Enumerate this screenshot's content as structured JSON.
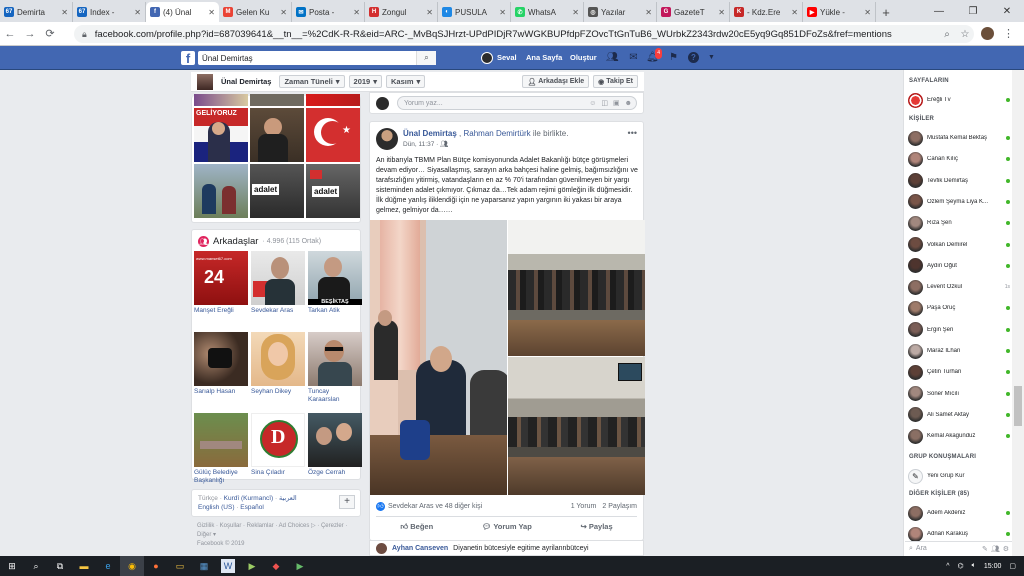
{
  "browser": {
    "tabs": [
      {
        "label": "Demirta",
        "icon": "67-site-icon",
        "color": "#1565c0",
        "glyph": "67",
        "active": false
      },
      {
        "label": "Index - ",
        "icon": "67-site-icon",
        "color": "#1565c0",
        "glyph": "67",
        "active": false
      },
      {
        "label": "(4) Ünal",
        "icon": "facebook-icon",
        "color": "#4267b2",
        "glyph": "f",
        "active": true
      },
      {
        "label": "Gelen Ku",
        "icon": "gmail-icon",
        "color": "#ea4335",
        "glyph": "M",
        "active": false
      },
      {
        "label": "Posta - ",
        "icon": "outlook-icon",
        "color": "#0072c6",
        "glyph": "✉",
        "active": false
      },
      {
        "label": "Zongul",
        "icon": "h-site-icon",
        "color": "#d32f2f",
        "glyph": "H",
        "active": false
      },
      {
        "label": "PUSULA",
        "icon": "pusula-icon",
        "color": "#1e88e5",
        "glyph": "◐",
        "active": false
      },
      {
        "label": "WhatsA",
        "icon": "whatsapp-icon",
        "color": "#25d366",
        "glyph": "✆",
        "active": false
      },
      {
        "label": "Yazılar ",
        "icon": "globe-icon",
        "color": "#555555",
        "glyph": "◎",
        "active": false
      },
      {
        "label": "GazeteT",
        "icon": "gazete-icon",
        "color": "#c2185b",
        "glyph": "G",
        "active": false
      },
      {
        "label": "- Kdz.Ere",
        "icon": "kdz-icon",
        "color": "#c62828",
        "glyph": "K",
        "active": false
      },
      {
        "label": "Yükle - ",
        "icon": "youtube-icon",
        "color": "#ff0000",
        "glyph": "▶",
        "active": false
      }
    ],
    "url": "facebook.com/profile.php?id=687039641&__tn__=%2CdK-R-R&eid=ARC-_MvBqSJHrzt-UPdPIDjR7wWGKBUPfdpFZOvcTtGnTuB6_WUrbkZ2343rdw20cE5yq9Gq851DFoZs&fref=mentions"
  },
  "fbheader": {
    "search_value": "Ünal Demirtaş",
    "user": "Seval",
    "home": "Ana Sayfa",
    "create": "Oluştur",
    "notif_count": "4"
  },
  "timeline_bar": {
    "name": "Ünal Demirtaş",
    "timeline": "Zaman Tüneli",
    "year": "2019",
    "month": "Kasım",
    "add_friend": "Arkadaşı Ekle",
    "follow": "Takip Et"
  },
  "photo_texts": {
    "gelecek": "GELİYORUZ",
    "adalet": "adalet"
  },
  "friends": {
    "title": "Arkadaşlar",
    "count": "· 4.996 (115 Ortak)",
    "list": [
      {
        "name": "Manşet Ereğli",
        "img_text": "24"
      },
      {
        "name": "Sevdekar Aras",
        "img_text": ""
      },
      {
        "name": "Tarkan Atik",
        "img_text": "BEŞİKTAŞ"
      },
      {
        "name": "Sarıalp Hasan",
        "img_text": ""
      },
      {
        "name": "Seyhan Dikey",
        "img_text": ""
      },
      {
        "name": "Tuncay Karaarslan",
        "img_text": ""
      },
      {
        "name": "Gülüç Belediye Başkanlığı",
        "img_text": ""
      },
      {
        "name": "Sina Çıladır",
        "img_text": "D"
      },
      {
        "name": "Özge Cerrah",
        "img_text": ""
      }
    ],
    "img_text_manset": "www.manset67.com"
  },
  "languages": {
    "line1a": "Türkçe",
    "line1b": "Kurdî (Kurmancî)",
    "line1c": "العربية",
    "line2a": "English (US)",
    "line2b": "Español",
    "add": "+"
  },
  "footer": {
    "links": "Gizlilik · Koşullar · Reklamlar · Ad Choices ▷ · Çerezler ·",
    "more": "Diğer",
    "copy": "Facebook © 2019"
  },
  "compose": {
    "placeholder": "Yorum yaz..."
  },
  "post": {
    "author": "Ünal Demirtaş",
    "with": "Rahman Demirtürk",
    "with_suffix": "ile birlikte.",
    "time": "Dün, 11:37",
    "privacy": "·",
    "text": "An itibarıyla TBMM Plan Bütçe komisyonunda Adalet Bakanlığı bütçe görüşmeleri devam ediyor… Siyasallaşmış, sarayın arka bahçesi haline gelmiş, bağımsızlığını ve tarafsızlığını yitirmiş, vatandaşların en az % 70'i tarafından güvenilmeyen bir yargı sisteminden adalet çıkmıyor. Çıkmaz da…Tek adam rejimi gömleğin ilk düğmesidir. İlk düğme yanlış iliklendiği için ne yaparsanız yapın yargının iki yakası bir araya gelmez, gelmiyor da……",
    "likes": "Sevdekar Aras ve 48 diğer kişi",
    "comments": "1 Yorum",
    "shares": "2 Paylaşım",
    "like_label": "Beğen",
    "comment_label": "Yorum Yap",
    "share_label": "Paylaş"
  },
  "comment": {
    "author": "Ayhan Canseven",
    "text": "Diyanetin bütcesiyle egitime ayrilannbütceyi"
  },
  "chat": {
    "pages_title": "SAYFALARIN",
    "page": "Ereğli Tv",
    "people_title": "KİŞİLER",
    "contacts": [
      {
        "name": "Mustafa Kemal Bektaş",
        "status": "online"
      },
      {
        "name": "Canan Kılıç",
        "status": "online"
      },
      {
        "name": "Tevfik Demirtaş",
        "status": "online"
      },
      {
        "name": "Özlem Şeyma Liya K...",
        "status": "online"
      },
      {
        "name": "Rıza Şen",
        "status": "online"
      },
      {
        "name": "Volkan Demirel",
        "status": "online"
      },
      {
        "name": "Aydın Öğüt",
        "status": "online"
      },
      {
        "name": "Levent Özkul",
        "status": "1s"
      },
      {
        "name": "Paşa Oruç",
        "status": "online"
      },
      {
        "name": "Ergin Şen",
        "status": "online"
      },
      {
        "name": "Maraz İLhan",
        "status": "online"
      },
      {
        "name": "Çetin Turhan",
        "status": "online"
      },
      {
        "name": "Soner Mıcılı",
        "status": "online"
      },
      {
        "name": "Ali Samet Aktay",
        "status": "online"
      },
      {
        "name": "Kemal Akagunduz",
        "status": "online"
      }
    ],
    "group_title": "GRUP KONUŞMALARI",
    "new_group": "Yeni Grup Kur",
    "other_title": "DİĞER KİŞİLER (85)",
    "others": [
      {
        "name": "Adem Akdeniz",
        "status": "online"
      },
      {
        "name": "Adnan Karakuş",
        "status": "online"
      }
    ],
    "search_placeholder": "Ara"
  },
  "taskbar": {
    "time": "15:00"
  }
}
